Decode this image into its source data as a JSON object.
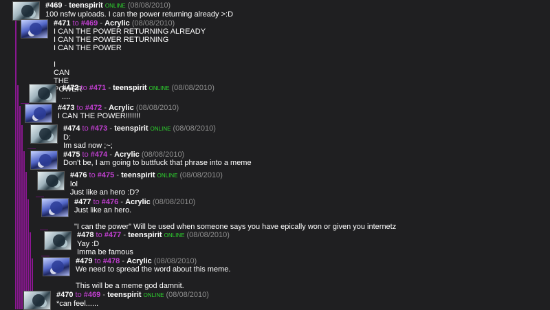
{
  "ui": {
    "to_word": "to",
    "dash": "-"
  },
  "comments": [
    {
      "id": "#469",
      "reply_to": "",
      "user": "teenspirit",
      "status": "ONLINE",
      "date": "(08/08/2010)",
      "avatar": "teenspirit-avatar",
      "lines": [
        "100 nsfw uploads. I can the power returning already >:D"
      ]
    },
    {
      "id": "#471",
      "reply_to": "#469",
      "user": "Acrylic",
      "status": "",
      "date": "(08/08/2010)",
      "avatar": "acrylic-avatar",
      "lines": [
        "I CAN THE POWER RETURNING ALREADY",
        "I CAN THE POWER RETURNING",
        "I CAN THE POWER",
        "",
        "I",
        "CAN",
        "THE",
        "POWER"
      ]
    },
    {
      "id": "#472",
      "reply_to": "#471",
      "user": "teenspirit",
      "status": "ONLINE",
      "date": "(08/08/2010)",
      "avatar": "teenspirit-avatar",
      "lines": [
        "...."
      ]
    },
    {
      "id": "#473",
      "reply_to": "#472",
      "user": "Acrylic",
      "status": "",
      "date": "(08/08/2010)",
      "avatar": "acrylic-avatar",
      "lines": [
        "I CAN THE POWER!!!!!!!"
      ]
    },
    {
      "id": "#474",
      "reply_to": "#473",
      "user": "teenspirit",
      "status": "ONLINE",
      "date": "(08/08/2010)",
      "avatar": "teenspirit-avatar",
      "lines": [
        "D:",
        "Im sad now ;~;"
      ]
    },
    {
      "id": "#475",
      "reply_to": "#474",
      "user": "Acrylic",
      "status": "",
      "date": "(08/08/2010)",
      "avatar": "acrylic-avatar",
      "lines": [
        "Don't be, I am going to buttfuck that phrase into a meme"
      ]
    },
    {
      "id": "#476",
      "reply_to": "#475",
      "user": "teenspirit",
      "status": "ONLINE",
      "date": "(08/08/2010)",
      "avatar": "teenspirit-avatar",
      "lines": [
        "lol",
        "Just like an hero :D?"
      ]
    },
    {
      "id": "#477",
      "reply_to": "#476",
      "user": "Acrylic",
      "status": "",
      "date": "(08/08/2010)",
      "avatar": "acrylic-avatar",
      "lines": [
        "Just like an hero.",
        "",
        "\"I can the power\" Will be used when someone says you have epically won or given you internetz"
      ]
    },
    {
      "id": "#478",
      "reply_to": "#477",
      "user": "teenspirit",
      "status": "ONLINE",
      "date": "(08/08/2010)",
      "avatar": "teenspirit-avatar",
      "lines": [
        "Yay :D",
        "Imma be famous"
      ]
    },
    {
      "id": "#479",
      "reply_to": "#478",
      "user": "Acrylic",
      "status": "",
      "date": "(08/08/2010)",
      "avatar": "acrylic-avatar",
      "lines": [
        "We need to spread the word about this meme.",
        "",
        "This will be a meme god damnit."
      ]
    },
    {
      "id": "#470",
      "reply_to": "#469",
      "user": "teenspirit",
      "status": "ONLINE",
      "date": "(08/08/2010)",
      "avatar": "teenspirit-avatar",
      "lines": [
        "*can feel......"
      ]
    }
  ]
}
